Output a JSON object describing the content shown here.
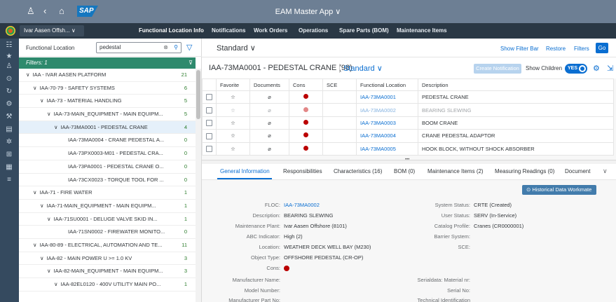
{
  "shell": {
    "app_title": "EAM Master App",
    "title_chevron": "∨",
    "user_icon": "user-icon",
    "back_icon": "back-icon",
    "home_icon": "home-icon",
    "logo_text": "SAP"
  },
  "nav": {
    "company": "Ivar Aasen Offsh...",
    "company_chevron": "∨",
    "tabs": [
      "Functional Location Info",
      "Notifications",
      "Work Orders",
      "Operations",
      "Spare Parts (BOM)",
      "Maintenance Items"
    ]
  },
  "tree": {
    "label": "Functional Location",
    "search_value": "pedestal",
    "filters_label": "Filters: 1",
    "rows": [
      {
        "text": "IAA - IVAR AASEN PLATFORM",
        "count": "21",
        "chev": "∨"
      },
      {
        "text": "IAA-70-79 - SAFETY SYSTEMS",
        "count": "6",
        "chev": "∨"
      },
      {
        "text": "IAA-73 - MATERIAL HANDLING",
        "count": "5",
        "chev": "∨"
      },
      {
        "text": "IAA-73-MAIN_EQUIPMENT - MAIN EQUIPM...",
        "count": "5",
        "chev": "∨"
      },
      {
        "text": "IAA-73MA0001 - PEDESTAL CRANE",
        "count": "4",
        "chev": "∨"
      },
      {
        "text": "IAA-73MA0004 - CRANE PEDESTAL A...",
        "count": "0",
        "chev": ""
      },
      {
        "text": "IAA-73PX0003-M01 - PEDESTAL CRA...",
        "count": "0",
        "chev": ""
      },
      {
        "text": "IAA-73PA0001 - PEDESTAL CRANE O...",
        "count": "0",
        "chev": ""
      },
      {
        "text": "IAA-73CX0023 - TORQUE TOOL FOR ...",
        "count": "0",
        "chev": ""
      },
      {
        "text": "IAA-71 - FIRE WATER",
        "count": "1",
        "chev": "∨"
      },
      {
        "text": "IAA-71-MAIN_EQUIPMENT - MAIN EQUIPM...",
        "count": "1",
        "chev": "∨"
      },
      {
        "text": "IAA-71SU0001 - DELUGE VALVE SKID IN...",
        "count": "1",
        "chev": "∨"
      },
      {
        "text": "IAA-71SN0002 - FIREWATER MONITO...",
        "count": "0",
        "chev": ""
      },
      {
        "text": "IAA-80-89 - ELECTRICAL, AUTOMATION AND TE...",
        "count": "11",
        "chev": "∨"
      },
      {
        "text": "IAA-82 - MAIN POWER U >= 1.0 KV",
        "count": "3",
        "chev": "∨"
      },
      {
        "text": "IAA-82-MAIN_EQUIPMENT - MAIN EQUIPM...",
        "count": "3",
        "chev": "∨"
      },
      {
        "text": "IAA-82EL0120 - 400V UTILITY MAIN PO...",
        "count": "1",
        "chev": "∨"
      }
    ]
  },
  "variant": {
    "title": "Standard",
    "chevron": "∨",
    "show_filter_bar": "Show Filter Bar",
    "restore": "Restore",
    "filters": "Filters",
    "go": "Go"
  },
  "table": {
    "title": "IAA-73MA0001 - PEDESTAL CRANE (98)",
    "variant": "Standard",
    "create_notification": "Create Notification",
    "show_children": "Show Children",
    "toggle_label": "YES",
    "columns": [
      "Favorite",
      "Documents",
      "Cons",
      "SCE",
      "Functional Location",
      "Description"
    ],
    "rows": [
      {
        "floc": "IAA-73MA0001",
        "desc": "PEDESTAL CRANE",
        "dim": false
      },
      {
        "floc": "IAA-73MA0002",
        "desc": "BEARING SLEWING",
        "dim": true
      },
      {
        "floc": "IAA-73MA0003",
        "desc": "BOOM CRANE",
        "dim": false
      },
      {
        "floc": "IAA-73MA0004",
        "desc": "CRANE PEDESTAL ADAPTOR",
        "dim": false
      },
      {
        "floc": "IAA-73MA0005",
        "desc": "HOOK BLOCK, WITHOUT SHOCK ABSORBER",
        "dim": false
      }
    ]
  },
  "tabs": [
    "General Information",
    "Responsibilities",
    "Characteristics (16)",
    "BOM (0)",
    "Maintenance Items (2)",
    "Measuring Readings (0)",
    "Document"
  ],
  "detail": {
    "historical_button": "Historical Data Workmate",
    "left": [
      {
        "label": "FLOC:",
        "value": "IAA-73MA0002",
        "link": true
      },
      {
        "label": "Description:",
        "value": "BEARING SLEWING"
      },
      {
        "label": "Maintenance Plant:",
        "value": "Ivar Aasen Offshore (8101)"
      },
      {
        "label": "ABC Indicator:",
        "value": "High (2)"
      },
      {
        "label": "Location:",
        "value": "WEATHER DECK WELL BAY (M230)"
      },
      {
        "label": "Object Type:",
        "value": "OFFSHORE PEDESTAL (CR-OP)"
      },
      {
        "label": "Cons:",
        "value": ""
      }
    ],
    "right": [
      {
        "label": "System Status:",
        "value": "CRTE (Created)"
      },
      {
        "label": "User Status:",
        "value": "SERV (In-Service)"
      },
      {
        "label": "Catalog Profile:",
        "value": "Cranes (CR0000001)"
      },
      {
        "label": "Barrier System:",
        "value": ""
      },
      {
        "label": "SCE:",
        "value": ""
      }
    ],
    "left2": [
      "Manufacturer Name:",
      "Model Number:",
      "Manufacturer Part No:"
    ],
    "right2": [
      "Serialdata: Material nr:",
      "Serial No:",
      "Technical Identification"
    ]
  }
}
